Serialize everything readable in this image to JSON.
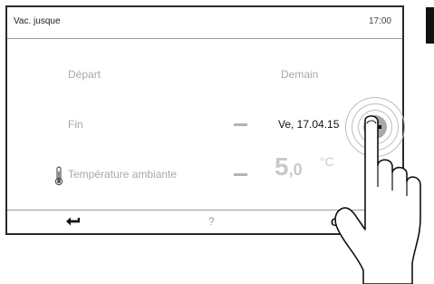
{
  "header": {
    "title": "Vac. jusque",
    "time": "17:00"
  },
  "rows": {
    "start": {
      "label": "Départ",
      "value": "Demain"
    },
    "end": {
      "label": "Fin",
      "value": "Ve, 17.04.15"
    },
    "temperature": {
      "label": "Température ambiante",
      "value_integer": "5",
      "value_decimal": ",0",
      "unit": "°C"
    }
  },
  "footer": {
    "help_label": "?",
    "ok_label": "OK"
  },
  "icons": {
    "thermometer": "thermometer-icon",
    "plus": "plus-icon",
    "back": "back-arrow-icon",
    "hand": "hand-pointer-icon"
  },
  "colors": {
    "frame": "#2a2a2a",
    "inactive_text": "#a8a8a8",
    "active_text": "#111111",
    "button_grey": "#a9a9a9"
  }
}
